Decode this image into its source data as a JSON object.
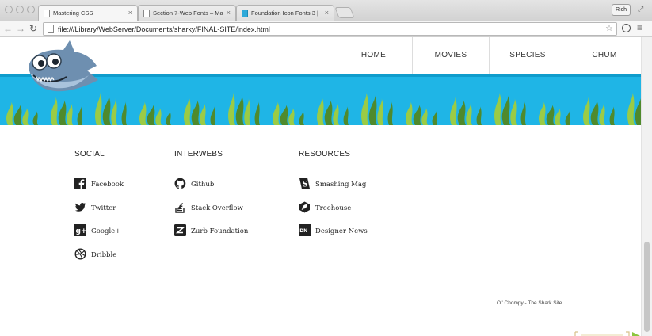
{
  "browser": {
    "tabs": [
      {
        "title": "Mastering CSS",
        "close": "×"
      },
      {
        "title": "Section 7-Web Fonts – Ma",
        "close": "×"
      },
      {
        "title": "Foundation Icon Fonts 3 |",
        "close": "×"
      }
    ],
    "user_button": "Rich",
    "url": "file:///Library/WebServer/Documents/sharky/FINAL-SITE/index.html"
  },
  "site": {
    "nav": [
      {
        "label": "HOME"
      },
      {
        "label": "MOVIES"
      },
      {
        "label": "SPECIES"
      },
      {
        "label": "CHUM"
      }
    ],
    "footer": {
      "columns": [
        {
          "heading": "SOCIAL",
          "links": [
            {
              "label": "Facebook",
              "icon": "facebook-icon"
            },
            {
              "label": "Twitter",
              "icon": "twitter-icon"
            },
            {
              "label": "Google+",
              "icon": "google-plus-icon"
            },
            {
              "label": "Dribble",
              "icon": "dribbble-icon"
            }
          ]
        },
        {
          "heading": "INTERWEBS",
          "links": [
            {
              "label": "Github",
              "icon": "github-icon"
            },
            {
              "label": "Stack Overflow",
              "icon": "stack-overflow-icon"
            },
            {
              "label": "Zurb Foundation",
              "icon": "zurb-icon"
            }
          ]
        },
        {
          "heading": "RESOURCES",
          "links": [
            {
              "label": "Smashing Mag",
              "icon": "smashing-mag-icon"
            },
            {
              "label": "Treehouse",
              "icon": "treehouse-icon"
            },
            {
              "label": "Designer News",
              "icon": "designer-news-icon"
            }
          ]
        }
      ],
      "copyright": "Ol' Chompy - The Shark Site"
    }
  },
  "colors": {
    "water": "#1fb5e6",
    "seaweed_light": "#9bcb45",
    "seaweed_dark": "#4f8a2c",
    "shark": "#6e8fb0"
  }
}
